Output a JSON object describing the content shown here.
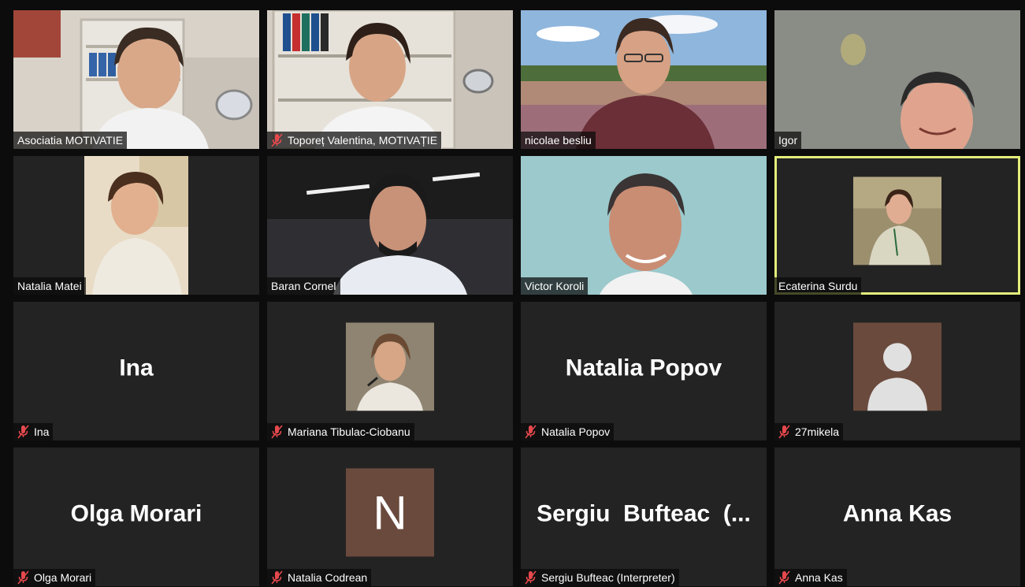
{
  "meeting": {
    "participants": [
      {
        "name": "Asociatia MOTIVATIE"
      },
      {
        "name": "Toporeț Valentina, MOTIVAȚIE",
        "muted": true
      },
      {
        "name": "nicolae besliu"
      },
      {
        "name": "Igor"
      },
      {
        "name": "Natalia Matei"
      },
      {
        "name": "Baran Cornel"
      },
      {
        "name": "Victor Koroli"
      },
      {
        "name": "Ecaterina Surdu",
        "active_speaker": true
      },
      {
        "name": "Ina",
        "muted": true,
        "display_name": "Ina"
      },
      {
        "name": "Mariana Tibulac-Ciobanu",
        "muted": true
      },
      {
        "name": "Natalia Popov",
        "muted": true,
        "display_name": "Natalia Popov"
      },
      {
        "name": "27mikela",
        "muted": true
      },
      {
        "name": "Olga Morari",
        "muted": true,
        "display_name": "Olga Morari"
      },
      {
        "name": "Natalia Codrean",
        "muted": true,
        "avatar_initial": "N"
      },
      {
        "name": "Sergiu Bufteac (Interpreter)",
        "muted": true,
        "display_name": "Sergiu  Bufteac  (..."
      },
      {
        "name": "Anna Kas",
        "muted": true,
        "display_name": "Anna Kas"
      }
    ]
  },
  "colors": {
    "active_speaker_border": "#e2ee7a",
    "muted_icon": "#e5484d",
    "tile_bg": "#232323",
    "avatar_bg": "#6a4a3d"
  },
  "icons": {
    "muted": "microphone-muted-icon",
    "avatar": "default-avatar-icon"
  }
}
